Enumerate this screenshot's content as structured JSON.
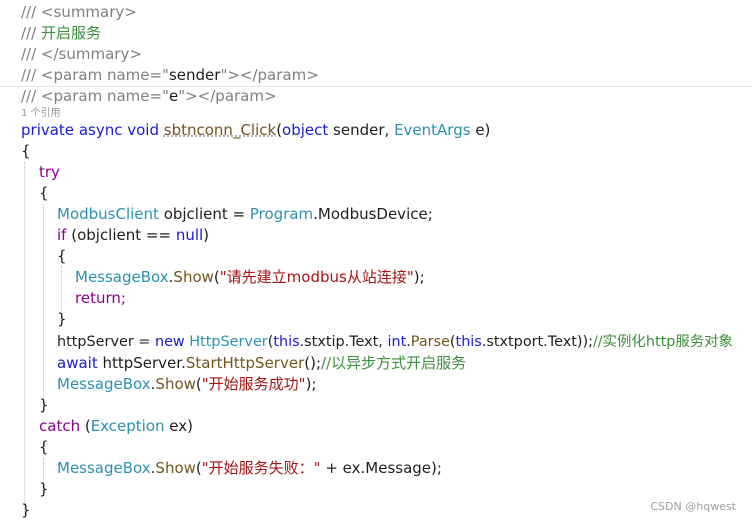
{
  "code": {
    "l1": "/// <summary>",
    "l2_prefix": "/// ",
    "l2_text": "开启服务",
    "l3": "/// </summary>",
    "l4_open": "/// <param name=\"",
    "l4_name": "sender",
    "l4_close": "\"></param>",
    "l5_open": "/// <param name=\"",
    "l5_name": "e",
    "l5_close": "\"></param>",
    "ref_hint": "1 个引用",
    "l6_kw1": "private",
    "l6_kw2": "async",
    "l6_kw3": "void",
    "l6_method": "sbtnconn_Click",
    "l6_paren": "(",
    "l6_kw4": "object",
    "l6_arg1": " sender, ",
    "l6_type": "EventArgs",
    "l6_arg2": " e)",
    "l7": "{",
    "l8": "try",
    "l9": "{",
    "l10_type": "ModbusClient",
    "l10_mid": " objclient = ",
    "l10_type2": "Program",
    "l10_end": ".ModbusDevice;",
    "l11_kw": "if",
    "l11_mid": " (objclient == ",
    "l11_null": "null",
    "l11_end": ")",
    "l12": "{",
    "l13_type": "MessageBox",
    "l13_dot": ".",
    "l13_meth": "Show",
    "l13_open": "(",
    "l13_str": "\"请先建立modbus从站连接\"",
    "l13_end": ");",
    "l14": "return;",
    "l15": "}",
    "l16_a": "httpServer = ",
    "l16_new": "new",
    "l16_type": "HttpServer",
    "l16_b": "(",
    "l16_this1": "this",
    "l16_c": ".stxtip.Text, ",
    "l16_int": "int",
    "l16_d": ".",
    "l16_parse": "Parse",
    "l16_e": "(",
    "l16_this2": "this",
    "l16_f": ".stxtport.Text));",
    "l16_comment": "//实例化http服务对象",
    "l17_kw": "await",
    "l17_a": " httpServer.",
    "l17_meth": "StartHttpServer",
    "l17_b": "();",
    "l17_comment": "//以异步方式开启服务",
    "l18_type": "MessageBox",
    "l18_dot": ".",
    "l18_meth": "Show",
    "l18_open": "(",
    "l18_str": "\"开始服务成功\"",
    "l18_end": ");",
    "l19": "}",
    "l20_kw": "catch",
    "l20_a": " (",
    "l20_type": "Exception",
    "l20_b": " ex)",
    "l21": "{",
    "l22_type": "MessageBox",
    "l22_dot": ".",
    "l22_meth": "Show",
    "l22_open": "(",
    "l22_str": "\"开始服务失败：\"",
    "l22_end": " + ex.Message);",
    "l23": "}",
    "l24": "}"
  },
  "watermark": "CSDN @hqwest",
  "colors": {
    "keyword": "#1a1ad2",
    "control": "#8b008b",
    "type": "#2b91af",
    "string": "#a31515",
    "comment": "#3c8f3c",
    "doc": "#808080"
  }
}
